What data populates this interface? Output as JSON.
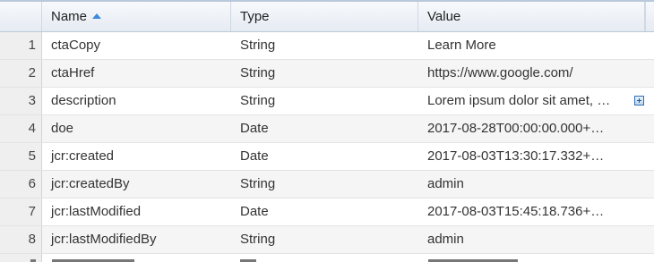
{
  "table": {
    "columns": {
      "name": "Name",
      "type": "Type",
      "value": "Value"
    },
    "rows": [
      {
        "num": "1",
        "name": "ctaCopy",
        "type": "String",
        "value": "Learn More"
      },
      {
        "num": "2",
        "name": "ctaHref",
        "type": "String",
        "value": "https://www.google.com/"
      },
      {
        "num": "3",
        "name": "description",
        "type": "String",
        "value": "Lorem ipsum dolor sit amet, …"
      },
      {
        "num": "4",
        "name": "doe",
        "type": "Date",
        "value": "2017-08-28T00:00:00.000+…"
      },
      {
        "num": "5",
        "name": "jcr:created",
        "type": "Date",
        "value": "2017-08-03T13:30:17.332+…"
      },
      {
        "num": "6",
        "name": "jcr:createdBy",
        "type": "String",
        "value": "admin"
      },
      {
        "num": "7",
        "name": "jcr:lastModified",
        "type": "Date",
        "value": "2017-08-03T15:45:18.736+…"
      },
      {
        "num": "8",
        "name": "jcr:lastModifiedBy",
        "type": "String",
        "value": "admin"
      }
    ],
    "sort": {
      "column": "name",
      "direction": "ascending",
      "icon": "sort-ascending-icon"
    },
    "expand_icon": "expand-plus-icon",
    "accent_color": "#3d8bd9"
  }
}
